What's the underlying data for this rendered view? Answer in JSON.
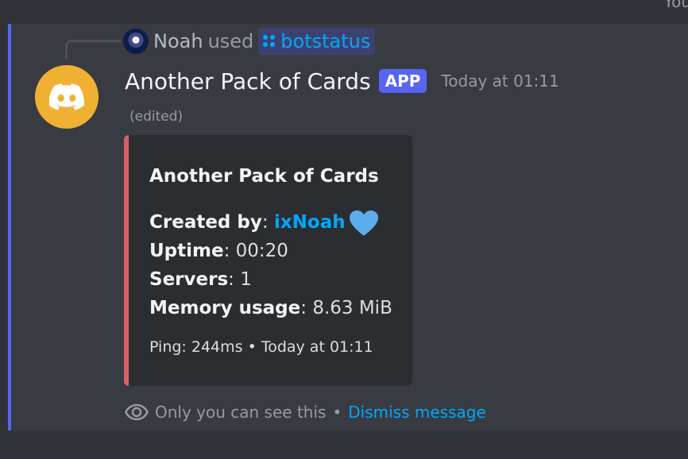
{
  "top_cut_text": "You",
  "reply": {
    "user": "Noah",
    "used_text": "used",
    "command": "botstatus"
  },
  "message": {
    "bot_name": "Another Pack of Cards",
    "badge": "APP",
    "timestamp": "Today at 01:11",
    "edited": "(edited)"
  },
  "embed": {
    "color": "#da6064",
    "title": "Another Pack of Cards",
    "fields": [
      {
        "label": "Created by",
        "value": "ixNoah",
        "is_link": true,
        "emoji": "blue-heart"
      },
      {
        "label": "Uptime",
        "value": "00:20"
      },
      {
        "label": "Servers",
        "value": "1"
      },
      {
        "label": "Memory usage",
        "value": "8.63 MiB"
      }
    ],
    "footer": "Ping: 244ms • Today at 01:11"
  },
  "ephemeral": {
    "notice": "Only you can see this",
    "separator": "•",
    "dismiss_label": "Dismiss message"
  },
  "colors": {
    "background": "#313338",
    "highlight": "#5865f2",
    "avatar": "#f0b132",
    "link": "#00a8fc"
  }
}
